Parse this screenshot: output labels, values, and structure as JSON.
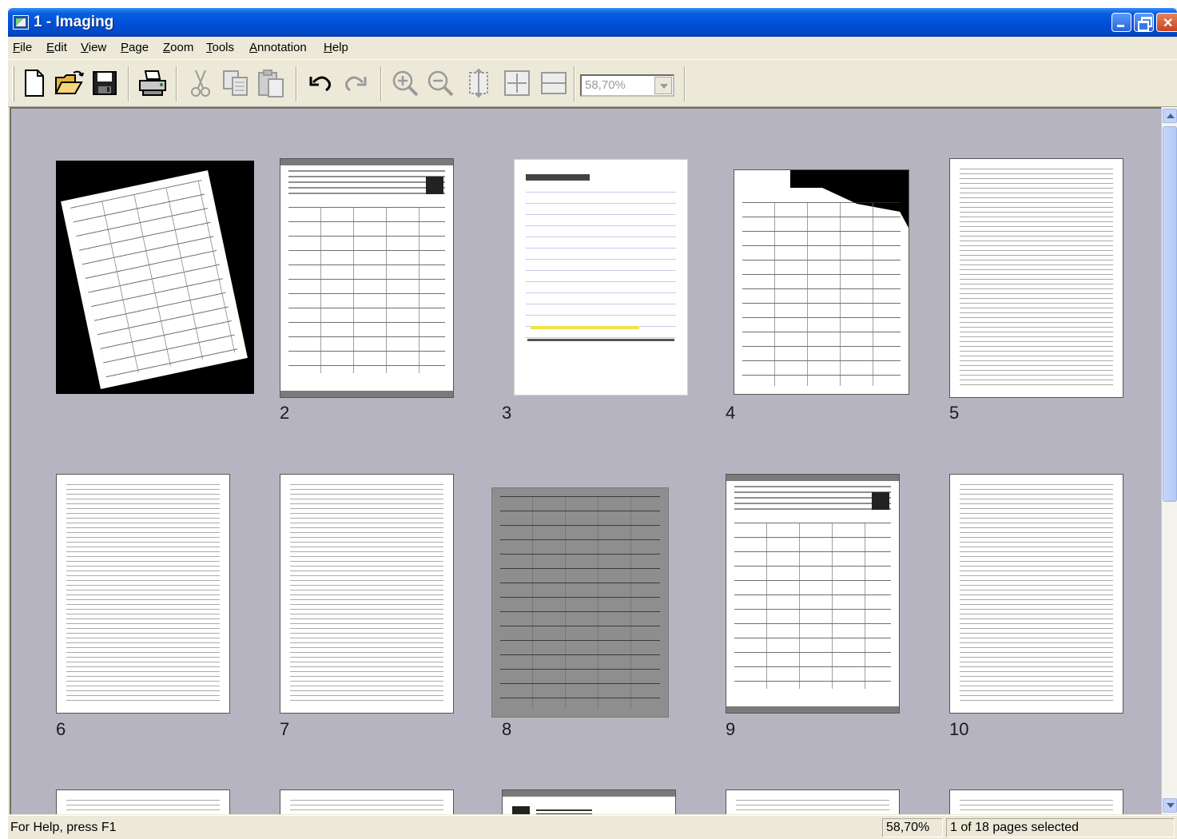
{
  "window": {
    "title": "1 - Imaging"
  },
  "menu": [
    "File",
    "Edit",
    "View",
    "Page",
    "Zoom",
    "Tools",
    "Annotation",
    "Help"
  ],
  "toolbar": {
    "buttons": [
      {
        "name": "new-icon",
        "enabled": true
      },
      {
        "name": "open-folder-icon",
        "enabled": true
      },
      {
        "name": "save-icon",
        "enabled": true
      },
      {
        "name": "print-icon",
        "enabled": true
      },
      {
        "name": "cut-icon",
        "enabled": false
      },
      {
        "name": "copy-icon",
        "enabled": false
      },
      {
        "name": "paste-icon",
        "enabled": false
      },
      {
        "name": "undo-icon",
        "enabled": true
      },
      {
        "name": "redo-icon",
        "enabled": false
      },
      {
        "name": "zoom-in-icon",
        "enabled": false
      },
      {
        "name": "zoom-out-icon",
        "enabled": false
      },
      {
        "name": "fit-height-icon",
        "enabled": false
      },
      {
        "name": "fit-page-icon",
        "enabled": false
      },
      {
        "name": "fit-width-icon",
        "enabled": false
      }
    ],
    "zoom_value": "58,70%"
  },
  "thumbnails": [
    {
      "label": "",
      "style": "skewed-form"
    },
    {
      "label": "2",
      "style": "invoice"
    },
    {
      "label": "3",
      "style": "lab-request"
    },
    {
      "label": "4",
      "style": "federal-form"
    },
    {
      "label": "5",
      "style": "text"
    },
    {
      "label": "6",
      "style": "text"
    },
    {
      "label": "7",
      "style": "text"
    },
    {
      "label": "8",
      "style": "grey-form"
    },
    {
      "label": "9",
      "style": "invoice"
    },
    {
      "label": "10",
      "style": "text"
    },
    {
      "label": "",
      "style": "text"
    },
    {
      "label": "",
      "style": "text"
    },
    {
      "label": "",
      "style": "header-form"
    },
    {
      "label": "",
      "style": "text"
    },
    {
      "label": "",
      "style": "text"
    }
  ],
  "status": {
    "help_text": "For Help, press F1",
    "zoom": "58,70%",
    "selection": "1 of 18 pages selected"
  },
  "colors": {
    "titlebar": "#0052d9",
    "chrome": "#ece9d8",
    "thumbnail_background": "#b7b4c2"
  }
}
